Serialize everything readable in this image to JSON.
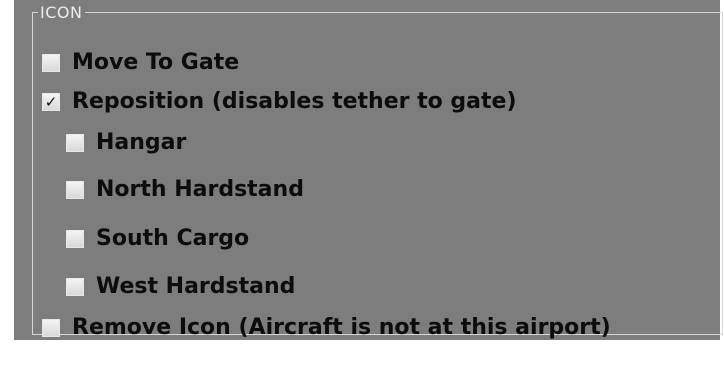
{
  "group": {
    "title": "ICON"
  },
  "options": {
    "move_to_gate": {
      "label": "Move To Gate",
      "checked": false
    },
    "reposition": {
      "label": "Reposition (disables tether to gate)",
      "checked": true,
      "check_glyph": "✓"
    },
    "hangar": {
      "label": "Hangar",
      "checked": false
    },
    "north_hardstand": {
      "label": "North Hardstand",
      "checked": false
    },
    "south_cargo": {
      "label": "South Cargo",
      "checked": false
    },
    "west_hardstand": {
      "label": "West Hardstand",
      "checked": false
    },
    "remove_icon": {
      "label": "Remove Icon (Aircraft is not at this airport)",
      "checked": false
    }
  },
  "colors": {
    "panel_background": "#7d7d7d",
    "frame_border": "#d6d6d6",
    "title_text": "#ececec",
    "label_text": "#0c0c0c"
  }
}
